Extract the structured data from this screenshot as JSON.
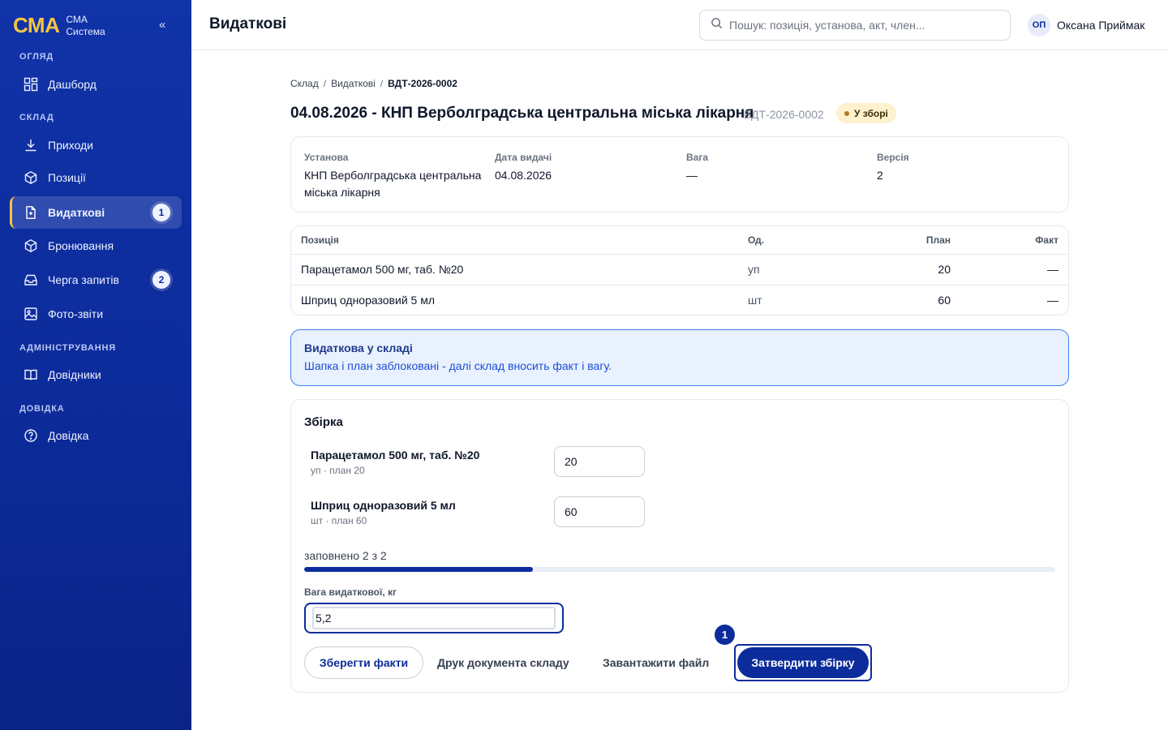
{
  "brand": {
    "logo": "СМА",
    "line1": "СМА",
    "line2": "Система",
    "collapse_label": "«"
  },
  "sidebar": {
    "sections": [
      {
        "label": "ОГЛЯД"
      },
      {
        "label": "СКЛАД"
      },
      {
        "label": "АДМІНІСТРУВАННЯ"
      },
      {
        "label": "ДОВІДКА"
      }
    ],
    "items": [
      {
        "label": "Дашборд",
        "icon": "dashboard-icon"
      },
      {
        "label": "Приходи",
        "icon": "download-icon"
      },
      {
        "label": "Позиції",
        "icon": "box-icon"
      },
      {
        "label": "Видаткові",
        "icon": "document-icon",
        "badge": "1",
        "active": true
      },
      {
        "label": "Бронювання",
        "icon": "box-icon"
      },
      {
        "label": "Черга запитів",
        "icon": "inbox-icon",
        "badge": "2"
      },
      {
        "label": "Фото-звіти",
        "icon": "image-icon"
      },
      {
        "label": "Довідники",
        "icon": "book-icon"
      },
      {
        "label": "Довідка",
        "icon": "help-icon"
      }
    ]
  },
  "header": {
    "title": "Видаткові",
    "search_placeholder": "Пошук: позиція, установа, акт, член...",
    "user_initials": "ОП",
    "user_name": "Оксана Приймак"
  },
  "breadcrumb": {
    "items": [
      "Склад",
      "Видаткові"
    ],
    "separator": "/",
    "current": "ВДТ-2026-0002"
  },
  "doc": {
    "title": "04.08.2026 - КНП Верболградська центральна міська лікарня",
    "code": "ВДТ-2026-0002",
    "status": "У зборі"
  },
  "info": {
    "institution_label": "Установа",
    "institution_value": "КНП Верболградська центральна міська лікарня",
    "date_label": "Дата видачі",
    "date_value": "04.08.2026",
    "weight_label": "Вага",
    "weight_value": "—",
    "version_label": "Версія",
    "version_value": "2"
  },
  "table": {
    "headers": {
      "position": "Позиція",
      "unit": "Од.",
      "plan": "План",
      "fact": "Факт"
    },
    "rows": [
      {
        "position": "Парацетамол 500 мг, таб. №20",
        "unit": "уп",
        "plan": "20",
        "fact": "—"
      },
      {
        "position": "Шприц одноразовий 5 мл",
        "unit": "шт",
        "plan": "60",
        "fact": "—"
      }
    ]
  },
  "notice": {
    "title": "Видаткова у складі",
    "text": "Шапка і план заблоковані - далі склад вносить факт і вагу."
  },
  "picking": {
    "title": "Збірка",
    "items": [
      {
        "name": "Парацетамол 500 мг, таб. №20",
        "sub": "уп · план 20",
        "value": "20"
      },
      {
        "name": "Шприц одноразовий 5 мл",
        "sub": "шт · план 60",
        "value": "60"
      }
    ],
    "filled_text": "заповнено 2 з 2",
    "progress_fraction": 0.305,
    "weight_label": "Вага видаткової, кг",
    "weight_value": "5,2",
    "save_label": "Зберегти факти",
    "print_label": "Друк документа складу",
    "upload_label": "Завантажити файл",
    "approve_label": "Затвердити збірку",
    "step_badge": "1"
  },
  "colors": {
    "primary": "#0d2c9c",
    "accent": "#f5c542",
    "notice_bg": "#e8f1fd",
    "status_bg": "#fdf1cf"
  }
}
